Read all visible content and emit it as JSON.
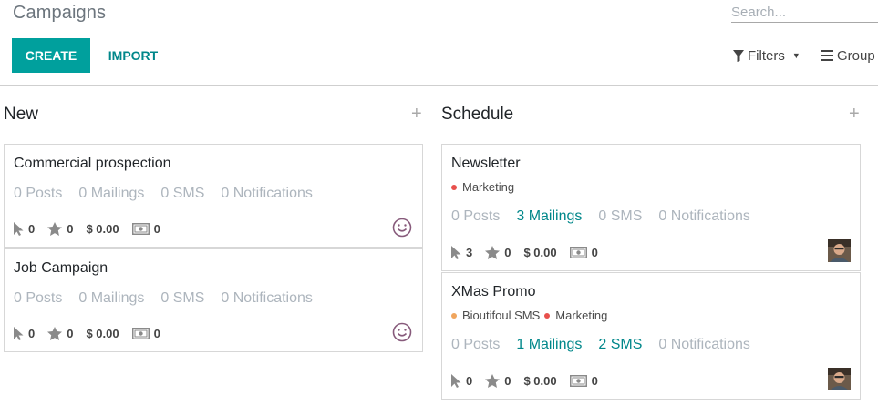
{
  "header": {
    "title": "Campaigns",
    "search_placeholder": "Search...",
    "create_label": "CREATE",
    "import_label": "IMPORT",
    "filters_label": "Filters",
    "group_label": "Group"
  },
  "colors": {
    "primary": "#00a09d",
    "link": "#00878a",
    "tag_marketing": "#e8504c",
    "tag_sms": "#f0a55d",
    "smiley": "#875a7b"
  },
  "columns": [
    {
      "title": "New",
      "cards": [
        {
          "title": "Commercial prospection",
          "tags": [],
          "posts": "0 Posts",
          "mailings": "0 Mailings",
          "sms": "0 SMS",
          "notifications": "0 Notifications",
          "clicks": "0",
          "favorites": "0",
          "revenue": "$ 0.00",
          "cash": "0"
        },
        {
          "title": "Job Campaign",
          "tags": [],
          "posts": "0 Posts",
          "mailings": "0 Mailings",
          "sms": "0 SMS",
          "notifications": "0 Notifications",
          "clicks": "0",
          "favorites": "0",
          "revenue": "$ 0.00",
          "cash": "0"
        }
      ]
    },
    {
      "title": "Schedule",
      "cards": [
        {
          "title": "Newsletter",
          "tags": [
            {
              "label": "Marketing",
              "color": "#e8504c"
            }
          ],
          "posts": "0 Posts",
          "mailings": "3 Mailings",
          "sms": "0 SMS",
          "notifications": "0 Notifications",
          "clicks": "3",
          "favorites": "0",
          "revenue": "$ 0.00",
          "cash": "0"
        },
        {
          "title": "XMas Promo",
          "tags": [
            {
              "label": "Bioutifoul SMS",
              "color": "#f0a55d"
            },
            {
              "label": "Marketing",
              "color": "#e8504c"
            }
          ],
          "posts": "0 Posts",
          "mailings": "1 Mailings",
          "sms": "2 SMS",
          "notifications": "0 Notifications",
          "clicks": "0",
          "favorites": "0",
          "revenue": "$ 0.00",
          "cash": "0"
        }
      ]
    }
  ]
}
